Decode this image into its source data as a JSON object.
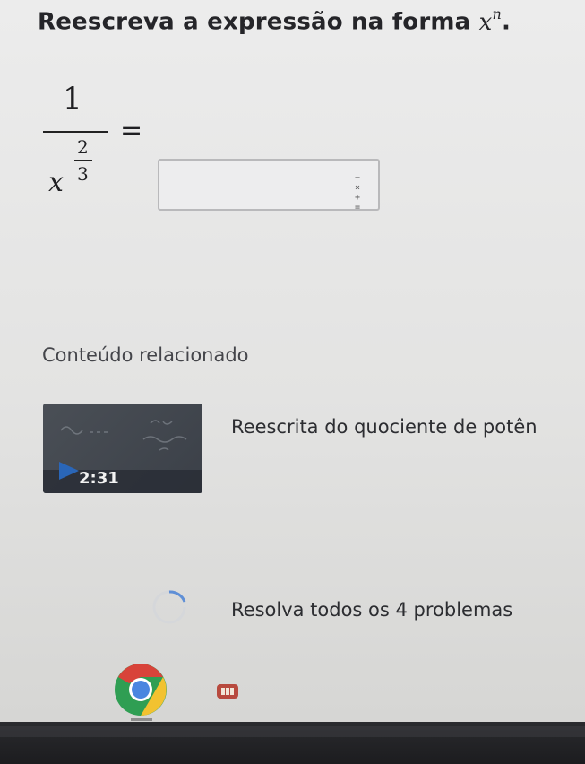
{
  "question": {
    "prefix": "Reescreva a expressão na forma ",
    "base": "x",
    "exponent": "n",
    "suffix": "."
  },
  "expression": {
    "numerator": "1",
    "base": "x",
    "exponent_numerator": "2",
    "exponent_denominator": "3",
    "equals": "="
  },
  "answer": {
    "value": "",
    "keypad_top": "− ×",
    "keypad_bottom": "+ ="
  },
  "related": {
    "section_title": "Conteúdo relacionado",
    "video": {
      "duration": "2:31",
      "title": "Reescrita do quociente de potên"
    },
    "practice": {
      "label": "Resolva todos os 4 problemas"
    }
  },
  "colors": {
    "play": "#2a66b8",
    "practice_circle": "#5f8fd6"
  },
  "icons": [
    "keypad-icon",
    "play-icon",
    "practice-circle-icon",
    "chrome-icon",
    "app-icon"
  ]
}
